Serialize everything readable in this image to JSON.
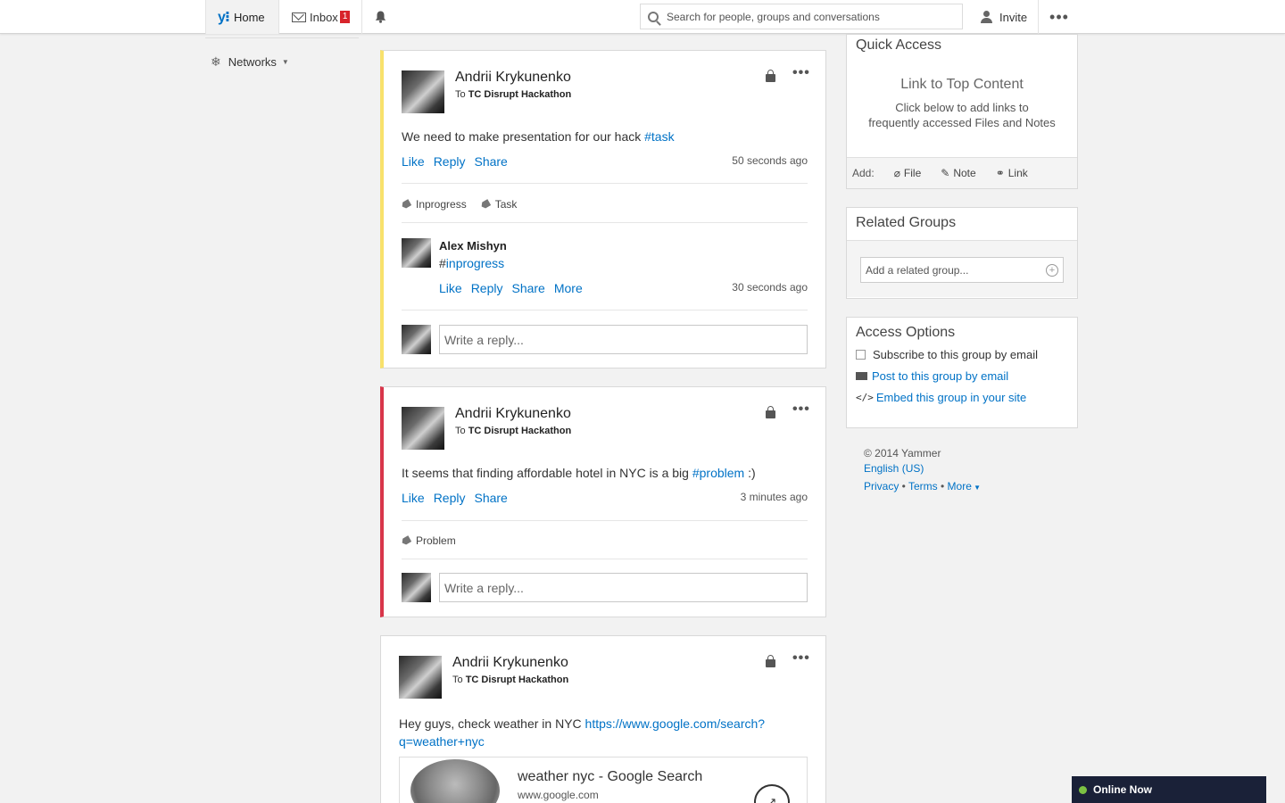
{
  "topbar": {
    "home_label": "Home",
    "inbox_label": "Inbox",
    "inbox_count": "1",
    "search_placeholder": "Search for people, groups and conversations",
    "invite_label": "Invite"
  },
  "leftnav": {
    "networks_label": "Networks"
  },
  "posts": [
    {
      "author": "Andrii Krykunenko",
      "to_prefix": "To",
      "group": "TC Disrupt Hackathon",
      "text": "We need to make presentation for our hack ",
      "hashtag": "#task",
      "actions": [
        "Like",
        "Reply",
        "Share"
      ],
      "time": "50 seconds ago",
      "tags": [
        "Inprogress",
        "Task"
      ],
      "comment": {
        "author": "Alex Mishyn",
        "hash_prefix": "#",
        "hashtag": "inprogress",
        "actions": [
          "Like",
          "Reply",
          "Share",
          "More"
        ],
        "time": "30 seconds ago"
      },
      "reply_placeholder": "Write a reply..."
    },
    {
      "author": "Andrii Krykunenko",
      "to_prefix": "To",
      "group": "TC Disrupt Hackathon",
      "text": "It seems that finding affordable hotel in NYC is a big ",
      "hashtag": "#problem",
      "text_suffix": " :)",
      "actions": [
        "Like",
        "Reply",
        "Share"
      ],
      "time": "3 minutes ago",
      "tags": [
        "Problem"
      ],
      "reply_placeholder": "Write a reply..."
    },
    {
      "author": "Andrii Krykunenko",
      "to_prefix": "To",
      "group": "TC Disrupt Hackathon",
      "text": "Hey guys, check weather in NYC ",
      "link_line1": "https://www.google.com/search?",
      "link_line2": "q=weather+nyc",
      "preview_title": "weather nyc - Google Search",
      "preview_url": "www.google.com"
    }
  ],
  "quick_access": {
    "title": "Quick Access",
    "sub_title": "Link to Top Content",
    "desc_line1": "Click below to add links to",
    "desc_line2": "frequently accessed Files and Notes",
    "add_label": "Add:",
    "file_label": "File",
    "note_label": "Note",
    "link_label": "Link"
  },
  "related_groups": {
    "title": "Related Groups",
    "placeholder": "Add a related group..."
  },
  "access_options": {
    "title": "Access Options",
    "subscribe": "Subscribe to this group by email",
    "post_by_email": "Post to this group by email",
    "embed": "Embed this group in your site"
  },
  "footer": {
    "copyright": "© 2014 Yammer",
    "language": "English (US)",
    "privacy": "Privacy",
    "terms": "Terms",
    "more": "More"
  },
  "online_now": "Online Now"
}
